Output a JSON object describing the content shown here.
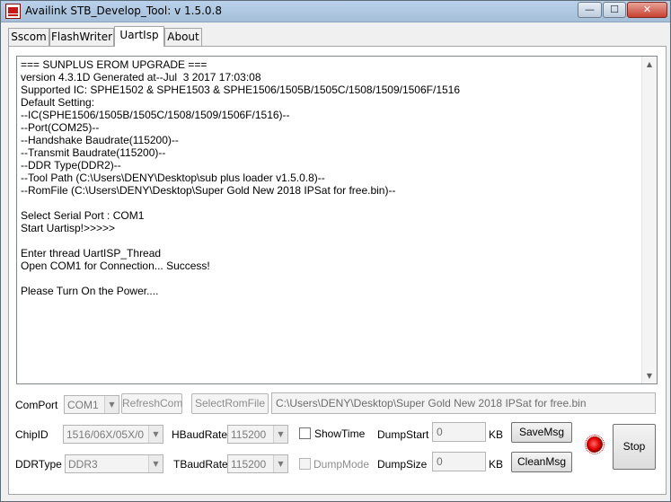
{
  "window": {
    "title": "Availink STB_Develop_Tool: v 1.5.0.8",
    "app_icon": "availink-logo-icon",
    "controls": {
      "minimize": "—",
      "maximize": "☐",
      "close": "✕"
    }
  },
  "tabs": [
    {
      "label": "Sscom",
      "active": false
    },
    {
      "label": "FlashWriter",
      "active": false
    },
    {
      "label": "UartIsp",
      "active": true
    },
    {
      "label": "About",
      "active": false
    }
  ],
  "log": {
    "lines": [
      "=== SUNPLUS EROM UPGRADE ===",
      "version 4.3.1D Generated at--Jul  3 2017 17:03:08",
      "Supported IC: SPHE1502 & SPHE1503 & SPHE1506/1505B/1505C/1508/1509/1506F/1516",
      "Default Setting:",
      "--IC(SPHE1506/1505B/1505C/1508/1509/1506F/1516)--",
      "--Port(COM25)--",
      "--Handshake Baudrate(115200)--",
      "--Transmit Baudrate(115200)--",
      "--DDR Type(DDR2)--",
      "--Tool Path (C:\\Users\\DENY\\Desktop\\sub plus loader v1.5.0.8)--",
      "--RomFile (C:\\Users\\DENY\\Desktop\\Super Gold New 2018 IPSat for free.bin)--",
      "",
      "Select Serial Port : COM1",
      "Start Uartisp!>>>>>",
      "",
      "Enter thread UartISP_Thread",
      "Open COM1 for Connection... Success!",
      "",
      "Please Turn On the Power...."
    ]
  },
  "controls": {
    "comport_label": "ComPort",
    "comport_value": "COM1",
    "refresh_label": "RefreshCom",
    "selectrom_label": "SelectRomFile",
    "romfile_path": "C:\\Users\\DENY\\Desktop\\Super Gold New 2018 IPSat for free.bin",
    "chipid_label": "ChipID",
    "chipid_value": "1516/06X/05X/0",
    "hbaud_label": "HBaudRate",
    "hbaud_value": "115200",
    "showtime_label": "ShowTime",
    "dumpstart_label": "DumpStart",
    "dumpstart_value": "0",
    "kb1": "KB",
    "savemsg_label": "SaveMsg",
    "stop_label": "Stop",
    "ddrtype_label": "DDRType",
    "ddrtype_value": "DDR3",
    "tbaud_label": "TBaudRate",
    "tbaud_value": "115200",
    "dumpmode_label": "DumpMode",
    "dumpsize_label": "DumpSize",
    "dumpsize_value": "0",
    "kb2": "KB",
    "cleanmsg_label": "CleanMsg"
  },
  "status_colors": {
    "led": "#e00000"
  },
  "scrollbar": {
    "up": "▲",
    "down": "▼"
  },
  "combo_arrow": "▼"
}
